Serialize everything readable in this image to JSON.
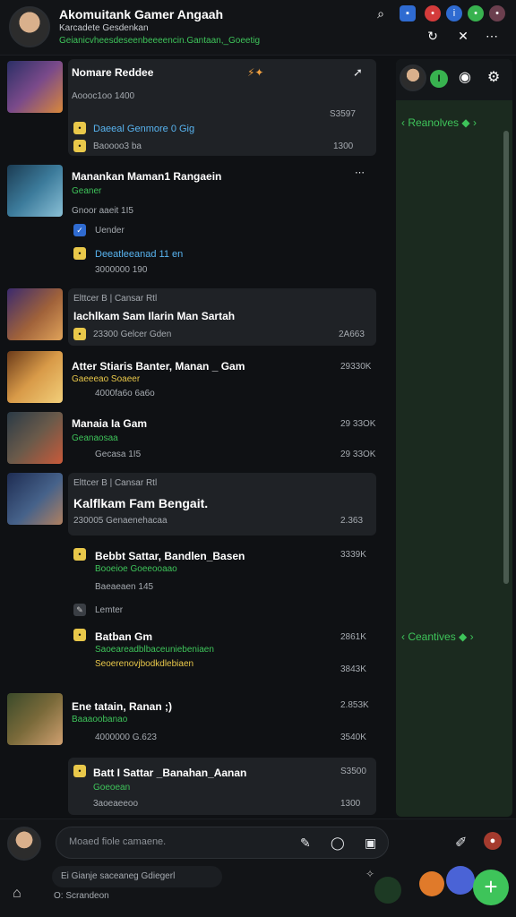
{
  "header": {
    "title": "Akomuitank Gamer Angaah",
    "subtitle": "Karcadete Gesdenkan",
    "status": "Geianicvheesdeseenbeeeencin.Gantaan,_Goeetig"
  },
  "feed": [
    {
      "title": "Nomare Reddee",
      "line1": "Aoooc1oo 1400",
      "line2": "Daeeal Genmore 0 Gig",
      "line3": "Baoooo3 ba",
      "r1": "S3597",
      "r2": "1300"
    },
    {
      "title": "Manankan Maman1 Rangaein",
      "line1": "Geaner",
      "line2": "Gnoor aaeit 1I5",
      "line3": "Uender",
      "line4": "Deeatleeanad 11 en",
      "line5": "3000000 190"
    },
    {
      "title": "Iachlkam Sam Ilarin Man Sartah",
      "pill": "Elttcer B | Cansar Rtl",
      "line1": "23300 Gelcer Gden",
      "r1": "2A663"
    },
    {
      "title": "Atter Stiaris Banter, Manan _ Gam",
      "line1": "Gaeeeao Soaeer",
      "line2": "4000fa6o 6a6o",
      "r1": "29330K"
    },
    {
      "title": "Manaia Ia Gam",
      "line1": "Geanaosaa",
      "line2": "Gecasa 1I5",
      "r1": "29 33OK",
      "r2": "29 33OK"
    },
    {
      "title": "Kalflkam Fam Bengait.",
      "pill": "Elttcer B | Cansar Rtl",
      "line1": "230005 Genaenehacaa",
      "r1": "2.363"
    },
    {
      "title": "Bebbt Sattar, Bandlen_Basen",
      "line1": "Booeioe Goeeooaao",
      "line2": "Baeaeaen 145",
      "line3": "Lemter",
      "r1": "3339K"
    },
    {
      "title": "Batban Gm",
      "line1": "Saoeareadblbaceuniebeniaen",
      "line2": "Seoerenovjbodkdlebiaen",
      "r1": "2861K",
      "r2": "3843K"
    },
    {
      "title": "Ene tatain, Ranan ;)",
      "line1": "Baaaoobanao",
      "line2": "4000000 G.623",
      "r1": "2.853K",
      "r2": "3540K"
    },
    {
      "title": "Batt I Sattar _Banahan_Aanan",
      "line1": "Goeoean",
      "line2": "3aoeaeeoo",
      "r1": "S3500",
      "r2": "1300"
    }
  ],
  "side": {
    "top_label": "I",
    "ribbon1": "Reanolves",
    "ribbon2": "Ceantives"
  },
  "footer": {
    "placeholder": "Moaed fiole camaene.",
    "chip": "Ei Gianje saceaneg Gdiegerl",
    "caption": "O: Scrandeon"
  },
  "colors": {
    "accent": "#3ec45a",
    "bg": "#0f1114",
    "card": "#1f2226",
    "side": "#1b2a1f"
  }
}
